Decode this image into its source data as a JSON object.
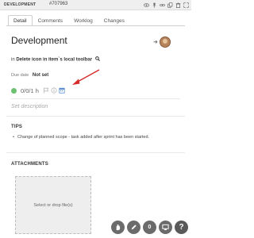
{
  "topbar": {
    "type_label": "DEVELOPMENT",
    "task_id": "#707963",
    "icons": [
      "eye-icon",
      "pin-icon",
      "link-icon",
      "copy-icon",
      "trash-icon",
      "expand-icon"
    ]
  },
  "tabs": [
    {
      "label": "Detail",
      "active": true
    },
    {
      "label": "Comments",
      "active": false
    },
    {
      "label": "Worklog",
      "active": false
    },
    {
      "label": "Changes",
      "active": false
    }
  ],
  "task": {
    "title": "Development",
    "assign_arrow": "➜",
    "context_prefix": "in",
    "context_name": "Delete icon in item`s local toolbar",
    "due_label": "Due date",
    "due_value": "Not set",
    "time_text": "0/0/1 h",
    "status_color": "#6cc070",
    "description_placeholder": "Set description"
  },
  "tips": {
    "heading": "TIPS",
    "items": [
      "Change of planned scope - task added after sprint has been started."
    ]
  },
  "attachments": {
    "heading": "ATTACHMENTS",
    "drop_label": "Select or drop file(s)"
  },
  "fab": {
    "count": "0",
    "help": "?"
  },
  "annotation": {
    "arrow_color": "#d62b2b"
  }
}
